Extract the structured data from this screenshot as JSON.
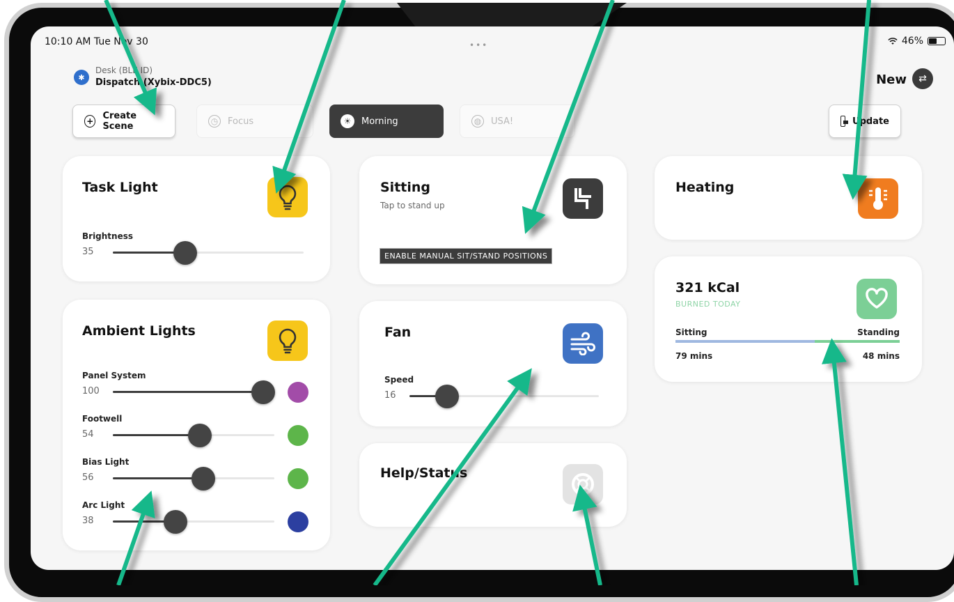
{
  "status_bar": {
    "time_date": "10:10 AM  Tue Nov 30",
    "dots": "•••",
    "battery": "46%"
  },
  "device": {
    "subtitle": "Desk (BLE ID)",
    "name": "Dispatch (Xybix-DDC5)",
    "new_label": "New"
  },
  "scenes": {
    "create": "Create Scene",
    "focus": "Focus",
    "morning": "Morning",
    "usa": "USA!",
    "update": "Update"
  },
  "task_light": {
    "title": "Task Light",
    "brightness_label": "Brightness",
    "brightness_value": "35",
    "brightness_fraction": 0.38
  },
  "sitting": {
    "title": "Sitting",
    "subtitle": "Tap to stand up",
    "manual_button": "ENABLE MANUAL SIT/STAND POSITIONS"
  },
  "heating": {
    "title": "Heating"
  },
  "ambient": {
    "title": "Ambient Lights",
    "channels": [
      {
        "label": "Panel System",
        "value": "100",
        "fraction": 1.0,
        "color": "#a24ca8"
      },
      {
        "label": "Footwell",
        "value": "54",
        "fraction": 0.54,
        "color": "#5db54a"
      },
      {
        "label": "Bias Light",
        "value": "56",
        "fraction": 0.56,
        "color": "#5db54a"
      },
      {
        "label": "Arc Light",
        "value": "38",
        "fraction": 0.39,
        "color": "#2c3fa0"
      }
    ]
  },
  "fan": {
    "title": "Fan",
    "speed_label": "Speed",
    "speed_value": "16",
    "speed_fraction": 0.2
  },
  "help": {
    "title": "Help/Status"
  },
  "calories": {
    "value": "321 kCal",
    "subtitle": "BURNED TODAY",
    "sitting_label": "Sitting",
    "standing_label": "Standing",
    "sitting_time": "79 mins",
    "standing_time": "48 mins",
    "sitting_fraction": 0.62,
    "sitting_color": "#9fb8e0",
    "standing_color": "#7ccf96"
  },
  "colors": {
    "light_tile": "#f6c61a",
    "fan_tile": "#3f72c4",
    "heating_tile": "#f07c1f",
    "heart_tile": "#7ccf96",
    "help_tile": "#e3e3e3",
    "arrow": "#14b88a"
  }
}
